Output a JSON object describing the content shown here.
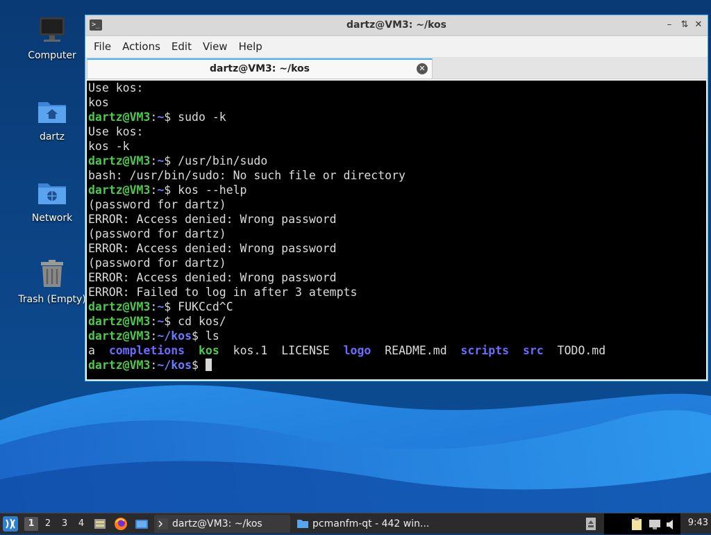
{
  "desktop": {
    "icons": [
      {
        "label": "Computer"
      },
      {
        "label": "dartz"
      },
      {
        "label": "Network"
      },
      {
        "label": "Trash (Empty)"
      }
    ]
  },
  "window": {
    "title": "dartz@VM3: ~/kos",
    "menu": [
      "File",
      "Actions",
      "Edit",
      "View",
      "Help"
    ],
    "tab_label": "dartz@VM3: ~/kos"
  },
  "terminal": {
    "lines": [
      {
        "type": "out",
        "text": "Use kos:"
      },
      {
        "type": "out",
        "text": "kos"
      },
      {
        "type": "cmd",
        "user": "dartz@VM3",
        "path": "~",
        "cmd": " sudo -k"
      },
      {
        "type": "out",
        "text": "Use kos:"
      },
      {
        "type": "out",
        "text": "kos -k"
      },
      {
        "type": "cmd",
        "user": "dartz@VM3",
        "path": "~",
        "cmd": " /usr/bin/sudo"
      },
      {
        "type": "out",
        "text": "bash: /usr/bin/sudo: No such file or directory"
      },
      {
        "type": "cmd",
        "user": "dartz@VM3",
        "path": "~",
        "cmd": " kos --help"
      },
      {
        "type": "out",
        "text": "(password for dartz)"
      },
      {
        "type": "out",
        "text": "ERROR: Access denied: Wrong password"
      },
      {
        "type": "out",
        "text": "(password for dartz)"
      },
      {
        "type": "out",
        "text": "ERROR: Access denied: Wrong password"
      },
      {
        "type": "out",
        "text": "(password for dartz)"
      },
      {
        "type": "out",
        "text": "ERROR: Access denied: Wrong password"
      },
      {
        "type": "out",
        "text": "ERROR: Failed to log in after 3 atempts"
      },
      {
        "type": "cmd",
        "user": "dartz@VM3",
        "path": "~",
        "cmd": " FUKCcd^C"
      },
      {
        "type": "cmd",
        "user": "dartz@VM3",
        "path": "~",
        "cmd": " cd kos/"
      },
      {
        "type": "cmd",
        "user": "dartz@VM3",
        "path": "~/kos",
        "cmd": " ls"
      }
    ],
    "ls": [
      {
        "name": "a",
        "kind": "file"
      },
      {
        "name": "completions",
        "kind": "dir"
      },
      {
        "name": "kos",
        "kind": "exe"
      },
      {
        "name": "kos.1",
        "kind": "file"
      },
      {
        "name": "LICENSE",
        "kind": "file"
      },
      {
        "name": "logo",
        "kind": "dir"
      },
      {
        "name": "README.md",
        "kind": "file"
      },
      {
        "name": "scripts",
        "kind": "dir"
      },
      {
        "name": "src",
        "kind": "dir"
      },
      {
        "name": "TODO.md",
        "kind": "file"
      }
    ],
    "prompt": {
      "user": "dartz@VM3",
      "path": "~/kos"
    },
    "colon": ":",
    "dollar": "$",
    "ls_separator": "  "
  },
  "taskbar": {
    "workspaces": [
      "1",
      "2",
      "3",
      "4"
    ],
    "tasks": [
      {
        "label": "dartz@VM3: ~/kos",
        "active": true
      },
      {
        "label": "pcmanfm-qt - 442 win...",
        "active": false
      }
    ],
    "clock": "9:43"
  },
  "colors": {
    "accent": "#3daee9",
    "prompt_user": "#4ec94e",
    "prompt_path": "#6b7bff",
    "terminal_bg": "#000000"
  }
}
